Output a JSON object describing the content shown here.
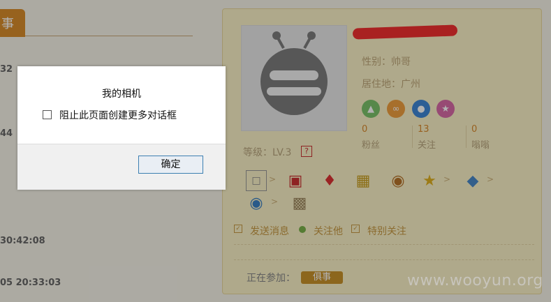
{
  "left": {
    "tab_label": "事",
    "times": [
      "32",
      "44",
      "30:42:08",
      "05 20:33:03"
    ]
  },
  "profile": {
    "gender": "性别：帅哥",
    "location": "居住地：广州",
    "stats": [
      {
        "value": "0",
        "label": "粉丝"
      },
      {
        "value": "13",
        "label": "关注"
      },
      {
        "value": "0",
        "label": "嗡嗡"
      }
    ],
    "level": "等级：LV.3",
    "level_help": "?",
    "actions": {
      "send_message": "发送消息",
      "follow": "关注他",
      "special_follow": "特别关注"
    },
    "joining_label": "正在参加：",
    "joining_tag": "俱事",
    "colors": {
      "accent": "#d98d2c",
      "redaction": "#f23030"
    }
  },
  "watermark": "www.wooyun.org",
  "dialog": {
    "title": "我的相机",
    "checkbox_label": "阻止此页面创建更多对话框",
    "ok_label": "确定"
  }
}
